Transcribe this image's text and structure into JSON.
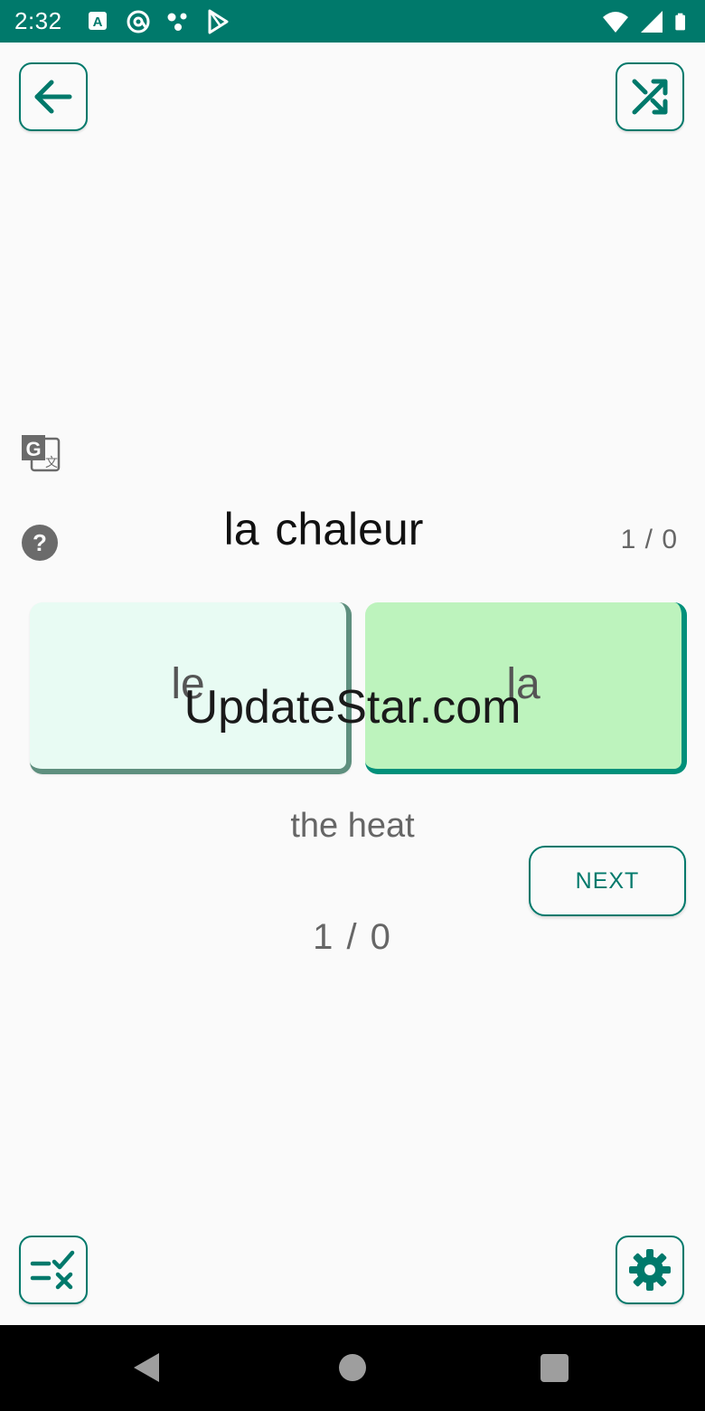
{
  "status_bar": {
    "time": "2:32",
    "left_icons": [
      "font-a-icon",
      "at-sign-icon",
      "network-dots-icon",
      "play-store-icon"
    ],
    "right_icons": [
      "wifi-icon",
      "signal-icon",
      "battery-icon"
    ]
  },
  "toolbar": {
    "back_icon": "arrow-left-icon",
    "shuffle_icon": "shuffle-icon"
  },
  "card": {
    "word": "la chaleur",
    "score_top": "1 / 0",
    "translation": "the heat",
    "score_bottom": "1 / 0",
    "options": [
      {
        "label": "le",
        "state": "default"
      },
      {
        "label": "la",
        "state": "correct"
      }
    ],
    "next_label": "NEXT"
  },
  "watermark": "UpdateStar.com",
  "bottom_bar": {
    "quiz_icon": "list-check-cross-icon",
    "settings_icon": "gear-icon"
  },
  "colors": {
    "primary": "#00796b",
    "correct_card": "#bdf3bd",
    "default_card": "#e8fbf3",
    "background": "#fafafa"
  }
}
